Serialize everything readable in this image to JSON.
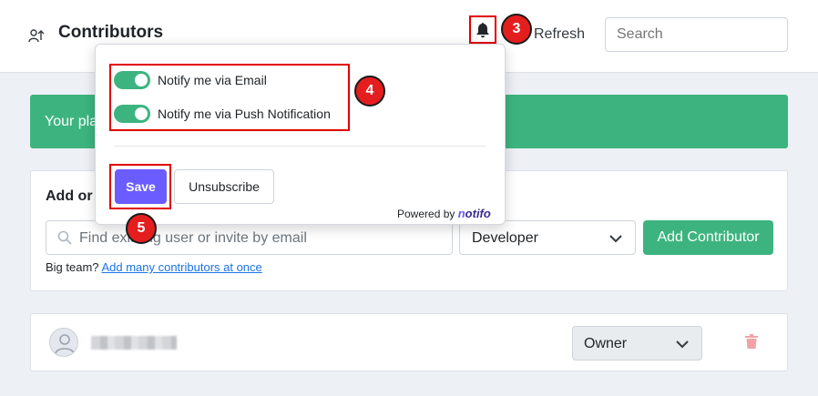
{
  "header": {
    "title": "Contributors",
    "refresh_label": "Refresh",
    "search_placeholder": "Search"
  },
  "banner": {
    "text": "Your pla"
  },
  "add_card": {
    "title": "Add or",
    "find_placeholder": "Find existing user or invite by email",
    "role_value": "Developer",
    "add_button": "Add Contributor",
    "bigteam_text": "Big team?",
    "bigteam_link": "Add many contributors at once"
  },
  "contributor_row": {
    "role_value": "Owner"
  },
  "popover": {
    "toggles": [
      {
        "label": "Notify me via Email",
        "on": true
      },
      {
        "label": "Notify me via Push Notification",
        "on": true
      }
    ],
    "save_label": "Save",
    "unsubscribe_label": "Unsubscribe",
    "powered_by": "Powered by",
    "brand_n": "n",
    "brand_rest": "otifo"
  },
  "steps": {
    "bell": "3",
    "toggles": "4",
    "save": "5"
  },
  "colors": {
    "accent_green": "#3db47f",
    "save_purple": "#6a5cff",
    "annotation_red": "#e00000"
  },
  "icons": {
    "title": "contributors-icon",
    "bell": "bell-icon",
    "search": "search-icon",
    "chevron": "chevron-down-icon",
    "avatar": "user-avatar-icon",
    "trash": "trash-icon"
  }
}
